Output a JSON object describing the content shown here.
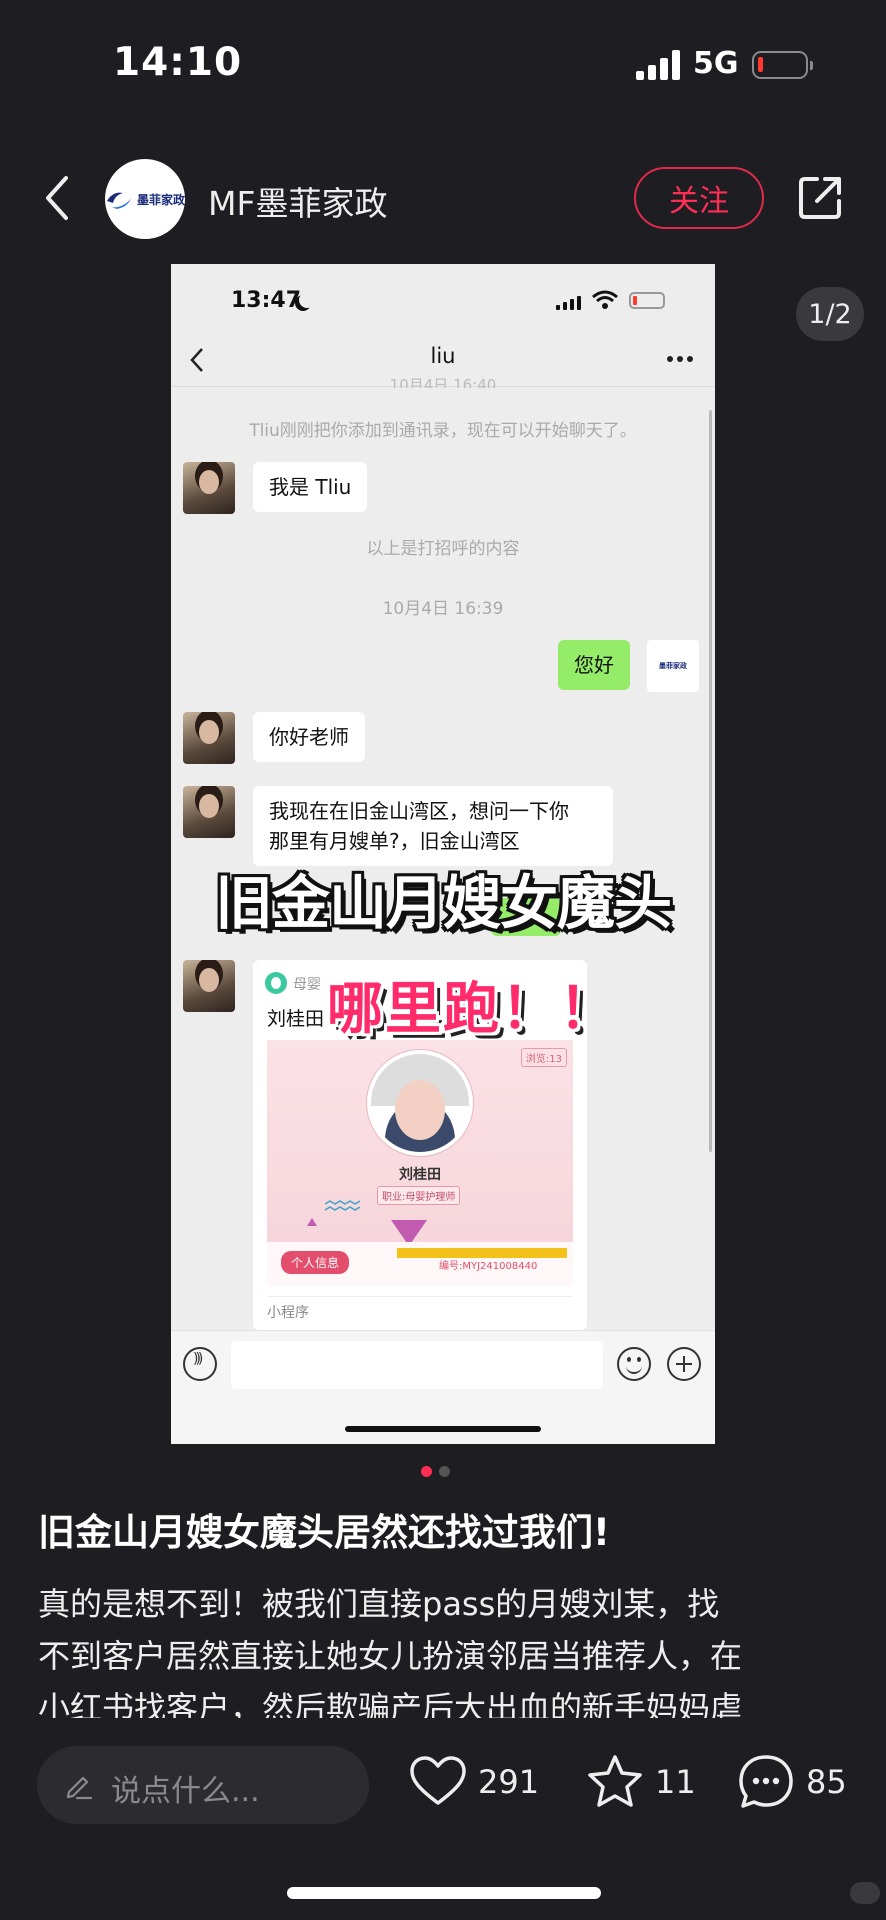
{
  "status_bar": {
    "time": "14:10",
    "network": "5G"
  },
  "header": {
    "author": "MF墨菲家政",
    "logo_text": "墨菲家政",
    "follow_label": "关注"
  },
  "pager": "1/2",
  "screenshot": {
    "status_time": "13:47",
    "chat_title": "liu",
    "faint_top": "10月4日 16:40",
    "system_msg": "Tliu刚刚把你添加到通讯录，现在可以开始聊天了。",
    "msg_1": "我是 Tliu",
    "greeting_note": "以上是打招呼的内容",
    "timestamp": "10月4日 16:39",
    "my_msg": "您好",
    "my_avatar_text": "墨菲家政",
    "msg_2": "你好老师",
    "msg_3_line1": "我现在在旧金山湾区，想问一下你",
    "msg_3_line2": "那里有月嫂单?，旧金山湾区",
    "card": {
      "source": "母婴",
      "name": "刘桂田",
      "views": "浏览:13",
      "person": "刘桂田",
      "job": "职业:母婴护理师",
      "tag": "个人信息",
      "code": "编号:MYJ241008440",
      "mini": "小程序"
    },
    "overlay_1": "旧金山月嫂女魔头",
    "overlay_2": "哪里跑！！"
  },
  "post": {
    "title": "旧金山月嫂女魔头居然还找过我们!",
    "body_1": "真的是想不到！被我们直接pass的月嫂刘某，找",
    "body_2": "不到客户居然直接让她女儿扮演邻居当推荐人，在",
    "body_3": "小红书找客户，然后欺骗产后大出血的新手妈妈虐"
  },
  "bottom_bar": {
    "comment_placeholder": "说点什么...",
    "likes": "291",
    "stars": "11",
    "comments": "85"
  },
  "colors": {
    "accent": "#ff2e55",
    "wechat_green": "#95ec69",
    "bg": "#1e1e22"
  }
}
